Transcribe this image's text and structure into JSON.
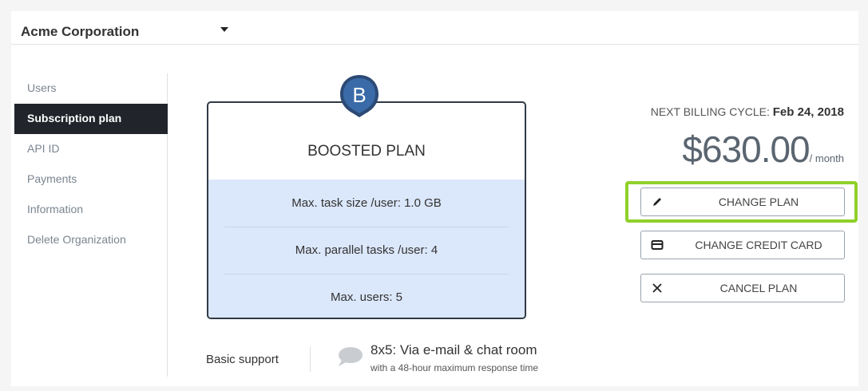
{
  "org": {
    "name": "Acme Corporation"
  },
  "sidebar": {
    "items": [
      {
        "label": "Users",
        "active": false
      },
      {
        "label": "Subscription plan",
        "active": true
      },
      {
        "label": "API ID",
        "active": false
      },
      {
        "label": "Payments",
        "active": false
      },
      {
        "label": "Information",
        "active": false
      },
      {
        "label": "Delete Organization",
        "active": false
      }
    ]
  },
  "plan": {
    "badge_letter": "B",
    "name": "BOOSTED PLAN",
    "features": [
      "Max. task size /user: 1.0 GB",
      "Max. parallel tasks /user: 4",
      "Max. users: 5"
    ]
  },
  "support": {
    "label": "Basic support",
    "main": "8x5: Via e-mail & chat room",
    "sub": "with a 48-hour maximum response time",
    "icon": "chat-bubble-icon"
  },
  "billing": {
    "label": "NEXT BILLING CYCLE:",
    "date": "Feb 24, 2018",
    "amount": "$630.00",
    "unit": "/ month"
  },
  "actions": {
    "change_plan": {
      "label": "CHANGE PLAN",
      "icon": "pencil-icon"
    },
    "change_card": {
      "label": "CHANGE CREDIT CARD",
      "icon": "credit-card-icon"
    },
    "cancel_plan": {
      "label": "CANCEL PLAN",
      "icon": "close-icon"
    }
  },
  "colors": {
    "sidebar_active_bg": "#21242b",
    "features_bg": "#dbe7fa",
    "highlight": "#8fd12a",
    "badge_bg": "#2c4a75"
  }
}
